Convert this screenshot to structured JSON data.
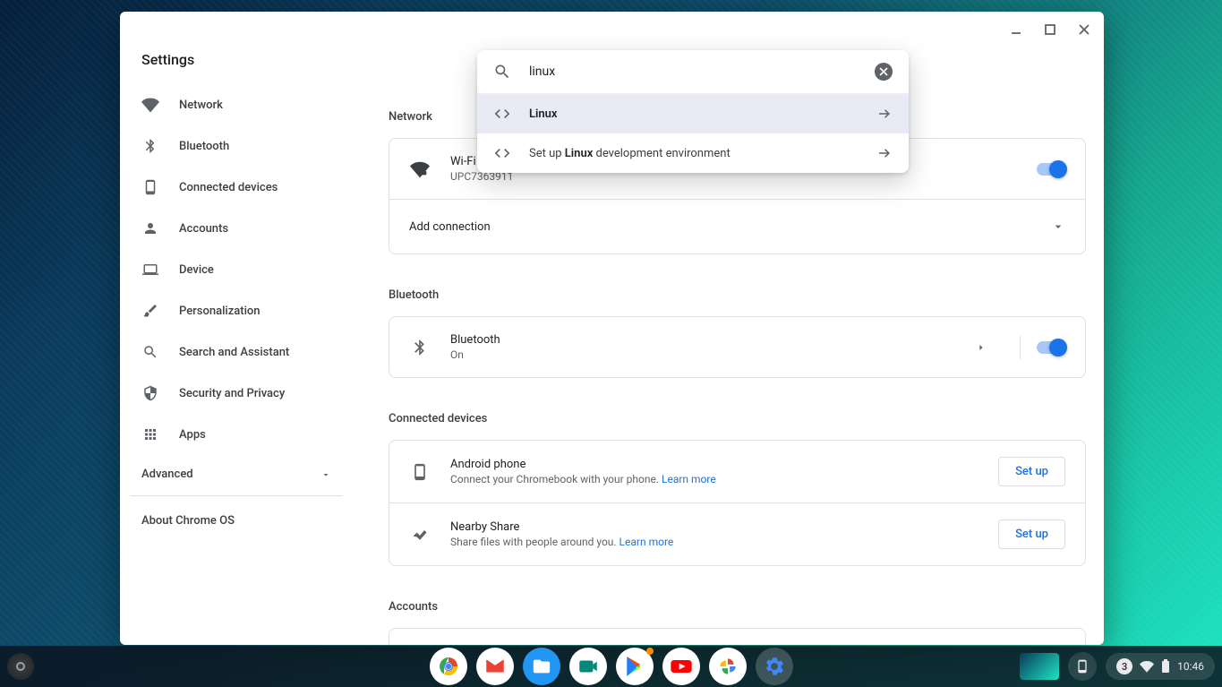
{
  "window_title": "Settings",
  "sidebar": {
    "items": [
      {
        "label": "Network"
      },
      {
        "label": "Bluetooth"
      },
      {
        "label": "Connected devices"
      },
      {
        "label": "Accounts"
      },
      {
        "label": "Device"
      },
      {
        "label": "Personalization"
      },
      {
        "label": "Search and Assistant"
      },
      {
        "label": "Security and Privacy"
      },
      {
        "label": "Apps"
      }
    ],
    "advanced": "Advanced",
    "about": "About Chrome OS"
  },
  "search": {
    "value": "linux",
    "results": [
      {
        "label": "Linux"
      },
      {
        "prefix": "Set up ",
        "bold": "Linux",
        "suffix": " development environment"
      }
    ]
  },
  "sections": {
    "network": {
      "title": "Network",
      "wifi_title": "Wi-Fi",
      "wifi_name": "UPC7363911",
      "add": "Add connection"
    },
    "bluetooth": {
      "title": "Bluetooth",
      "row_title": "Bluetooth",
      "row_sub": "On"
    },
    "connected": {
      "title": "Connected devices",
      "android_title": "Android phone",
      "android_sub": "Connect your Chromebook with your phone. ",
      "learn_more": "Learn more",
      "setup": "Set up",
      "nearby_title": "Nearby Share",
      "nearby_sub": "Share files with people around you. "
    },
    "accounts": {
      "title": "Accounts"
    }
  },
  "shelf": {
    "notification_count": "3",
    "time": "10:46"
  }
}
